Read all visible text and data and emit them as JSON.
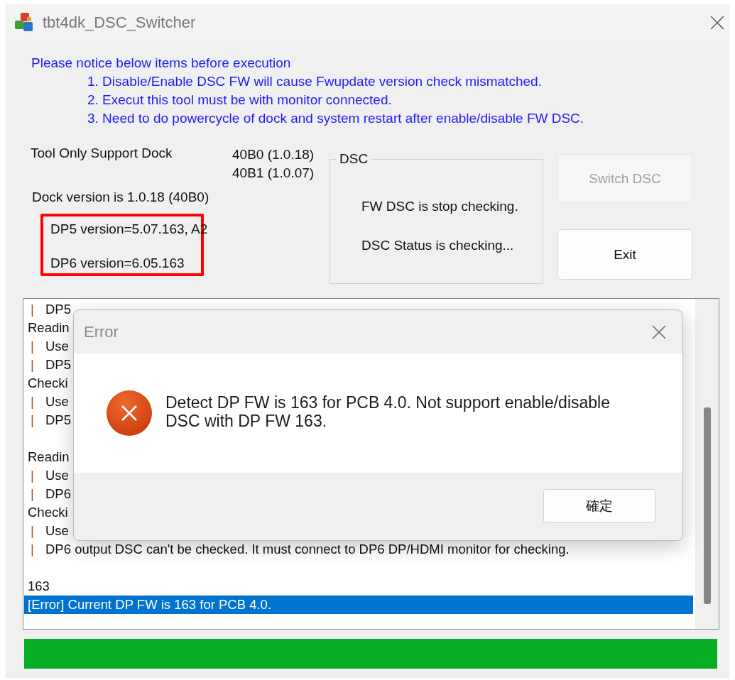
{
  "window": {
    "title": "tbt4dk_DSC_Switcher"
  },
  "notice": {
    "heading": "Please notice below items before execution",
    "items": [
      "1. Disable/Enable DSC FW will cause Fwupdate version check mismatched.",
      "2. Execut this tool must be with monitor connected.",
      "3. Need to do powercycle of dock and system restart after enable/disable FW DSC."
    ]
  },
  "support": {
    "label": "Tool Only Support Dock",
    "versions": [
      "40B0 (1.0.18)",
      "40B1 (1.0.07)"
    ]
  },
  "dock_version": "Dock version is 1.0.18 (40B0)",
  "dp_versions": {
    "highlighted": true,
    "lines": [
      "DP5 version=5.07.163, A2",
      "DP6 version=6.05.163"
    ]
  },
  "dsc_group": {
    "title": "DSC",
    "fw_status": "FW DSC is stop checking.",
    "dsc_status": "DSC Status is checking..."
  },
  "buttons": [
    {
      "label": "Switch DSC",
      "disabled": true
    },
    {
      "label": "Exit",
      "disabled": false
    }
  ],
  "log": {
    "lines": [
      {
        "kind": "text",
        "bar": "|",
        "text": "DP5",
        "selected": false
      },
      {
        "kind": "text",
        "text": "Readin",
        "selected": false
      },
      {
        "kind": "text",
        "bar": "|",
        "text": "Use",
        "selected": false
      },
      {
        "kind": "text",
        "bar": "|",
        "text": "DP5",
        "selected": false
      },
      {
        "kind": "text",
        "text": "Checki",
        "selected": false
      },
      {
        "kind": "text",
        "bar": "|",
        "text": "Use",
        "selected": false
      },
      {
        "kind": "text",
        "bar": "|",
        "text": "DP5",
        "selected": false
      },
      {
        "kind": "blank",
        "selected": false
      },
      {
        "kind": "text",
        "text": "Readin",
        "selected": false
      },
      {
        "kind": "text",
        "bar": "|",
        "text": "Use",
        "selected": false
      },
      {
        "kind": "text",
        "bar": "|",
        "text": "DP6",
        "selected": false
      },
      {
        "kind": "text",
        "text": "Checki",
        "selected": false
      },
      {
        "kind": "text",
        "bar": "|",
        "text": "Use",
        "selected": false
      },
      {
        "kind": "text",
        "bar": "|",
        "text": "DP6 output DSC can't be checked. It must connect to DP6 DP/HDMI monitor for checking.",
        "selected": false
      },
      {
        "kind": "blank",
        "selected": false
      },
      {
        "kind": "text",
        "text": "163",
        "selected": false
      },
      {
        "kind": "text",
        "text": "[Error] Current DP FW is 163 for PCB 4.0.",
        "selected": true
      }
    ]
  },
  "progress": {
    "level": 1
  },
  "dialog": {
    "title": "Error",
    "message": "Detect DP FW is 163 for PCB 4.0. Not support enable/disable DSC with DP FW 163.",
    "button": "確定"
  }
}
